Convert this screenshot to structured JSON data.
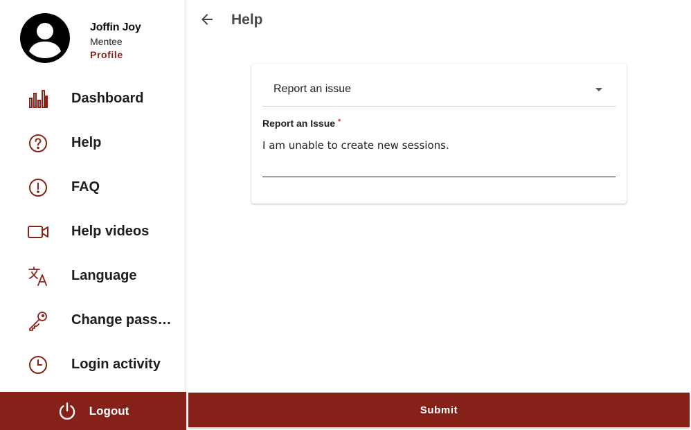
{
  "user": {
    "name": "Joffin Joy",
    "role": "Mentee",
    "profile_link": "Profile",
    "avatar_icon": "account-circle-icon"
  },
  "sidebar": {
    "items": [
      {
        "label": "Dashboard",
        "icon": "bar-chart-icon"
      },
      {
        "label": "Help",
        "icon": "question-circle-icon"
      },
      {
        "label": "FAQ",
        "icon": "exclamation-circle-icon"
      },
      {
        "label": "Help videos",
        "icon": "video-camera-icon"
      },
      {
        "label": "Language",
        "icon": "translate-icon"
      },
      {
        "label": "Change passw...",
        "icon": "key-icon"
      },
      {
        "label": "Login activity",
        "icon": "clock-icon"
      }
    ],
    "logout_label": "Logout",
    "logout_icon": "power-icon"
  },
  "header": {
    "title": "Help",
    "back_icon": "arrow-back-icon"
  },
  "form": {
    "select_value": "Report an issue",
    "field_label": "Report an Issue",
    "required_mark": "*",
    "textarea_value": "I am unable to create new sessions.",
    "submit_label": "Submit"
  },
  "colors": {
    "brand": "#86211a",
    "icon": "#8a2118"
  }
}
